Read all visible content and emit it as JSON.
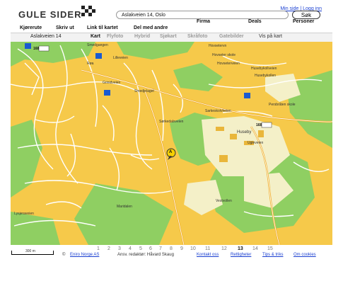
{
  "brand": {
    "logo_text": "GULE SIDER"
  },
  "top_links": {
    "my_page": "Min side",
    "separator": "|",
    "login": "Logg inn"
  },
  "search": {
    "value": "Aslakveien 14, Oslo",
    "button_label": "Søk"
  },
  "categories": [
    "Firma",
    "Deals",
    "Personer"
  ],
  "toolbar": {
    "items": [
      "Kjørerute",
      "Skriv ut",
      "Link til kartet",
      "Del med andre"
    ]
  },
  "map_header": {
    "address": "Aslakveien 14",
    "views": [
      "Kart",
      "Flyfoto",
      "Hybrid",
      "Sjøkart",
      "Skråfoto",
      "Gatebilder"
    ],
    "active_view": "Kart",
    "show_on_map": "Vis på kart"
  },
  "map": {
    "place_labels": [
      "Smedgangen",
      "Lilleveien",
      "Røa",
      "Grinidveien",
      "Smedjelaget",
      "Hovsetervn",
      "Hovseter skole",
      "Hovseterveien",
      "Husebykollveien",
      "Husebykollen",
      "Persbråten skole",
      "Sarkeskolvheien",
      "Huseby",
      "Ugleveien",
      "Sørkedalsveien",
      "Lysjeraveien",
      "Vestvollen",
      "Maridalen"
    ],
    "road_numbers": [
      "168",
      "168"
    ],
    "marker": {
      "label": "A",
      "color": "#f5d000"
    },
    "colors": {
      "urban": "#f6c94a",
      "park": "#8fcf62",
      "field": "#f4f0c8",
      "road": "#ffffff",
      "major_road": "#f0b030"
    }
  },
  "zoom_levels": [
    "1",
    "2",
    "3",
    "4",
    "5",
    "6",
    "7",
    "8",
    "9",
    "10",
    "11",
    "12",
    "13",
    "14",
    "15"
  ],
  "active_zoom": "13",
  "footer": {
    "copyright_symbol": "©",
    "copyright": "Eniro Norge AS",
    "editor": "Ansv. redaktør: Håvard Skaug",
    "links": [
      "Kontakt oss",
      "Rettigheter",
      "Tips & triks",
      "Om cookies"
    ]
  },
  "scale": {
    "label": "300 m"
  }
}
